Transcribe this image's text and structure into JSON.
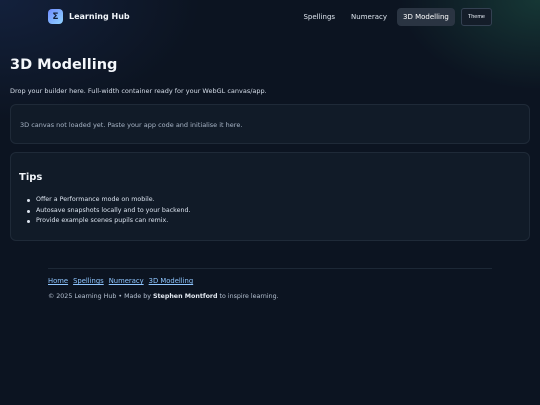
{
  "header": {
    "brand_glyph": "Σ",
    "brand_name": "Learning Hub",
    "nav": [
      {
        "label": "Spellings"
      },
      {
        "label": "Numeracy"
      },
      {
        "label": "3D Modelling",
        "active": true
      }
    ],
    "theme_label": "Theme"
  },
  "main": {
    "title": "3D Modelling",
    "subtitle": "Drop your builder here. Full-width container ready for your WebGL canvas/app.",
    "canvas_message": "3D canvas not loaded yet. Paste your app code and initialise it here.",
    "tips": {
      "title": "Tips",
      "items": [
        "Offer a Performance mode on mobile.",
        "Autosave snapshots locally and to your backend.",
        "Provide example scenes pupils can remix."
      ]
    }
  },
  "footer": {
    "links": [
      "Home",
      "Spellings",
      "Numeracy",
      "3D Modelling"
    ],
    "copyright_prefix": "© 2025 Learning Hub • Made by ",
    "author": "Stephen Montford",
    "copyright_suffix": " to inspire learning."
  },
  "colors": {
    "background": "#0c1421",
    "panel": "#111b28",
    "link": "#8fc6ff",
    "active_nav": "#2a3442"
  }
}
